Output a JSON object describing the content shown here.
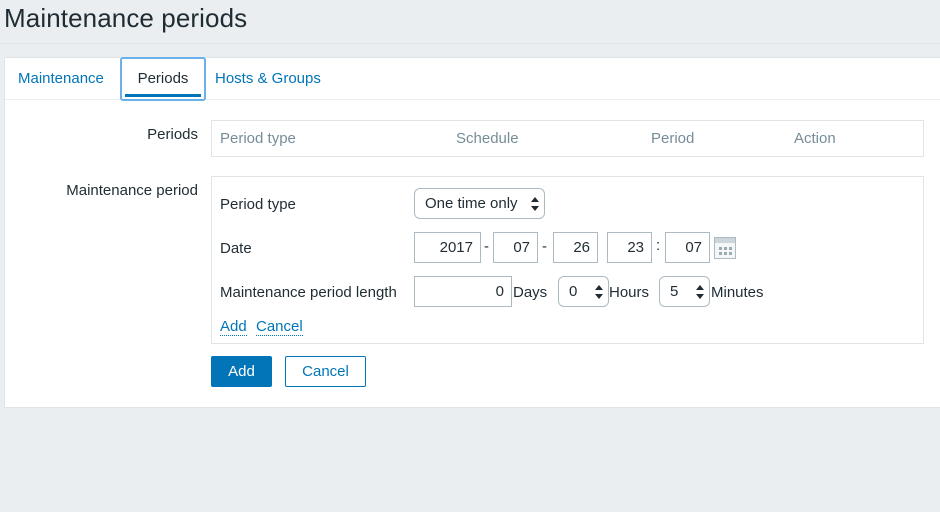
{
  "page": {
    "title": "Maintenance periods"
  },
  "tabs": [
    {
      "label": "Maintenance"
    },
    {
      "label": "Periods",
      "active": true
    },
    {
      "label": "Hosts & Groups"
    }
  ],
  "periods": {
    "label": "Periods",
    "columns": [
      "Period type",
      "Schedule",
      "Period",
      "Action"
    ]
  },
  "maintenance_period": {
    "label": "Maintenance period",
    "period_type": {
      "label": "Period type",
      "value": "One time only"
    },
    "date": {
      "label": "Date",
      "year": "2017",
      "month": "07",
      "day": "26",
      "hour": "23",
      "minute": "07",
      "sep_dash": "-",
      "sep_colon": ":"
    },
    "length": {
      "label": "Maintenance period length",
      "days": "0",
      "days_unit": "Days",
      "hours": "0",
      "hours_unit": "Hours",
      "minutes": "5",
      "minutes_unit": "Minutes"
    },
    "add_link": "Add",
    "cancel_link": "Cancel"
  },
  "buttons": {
    "add": "Add",
    "cancel": "Cancel"
  },
  "colors": {
    "accent": "#0275b8",
    "focus": "#6ab1ec",
    "muted": "#768d99"
  }
}
